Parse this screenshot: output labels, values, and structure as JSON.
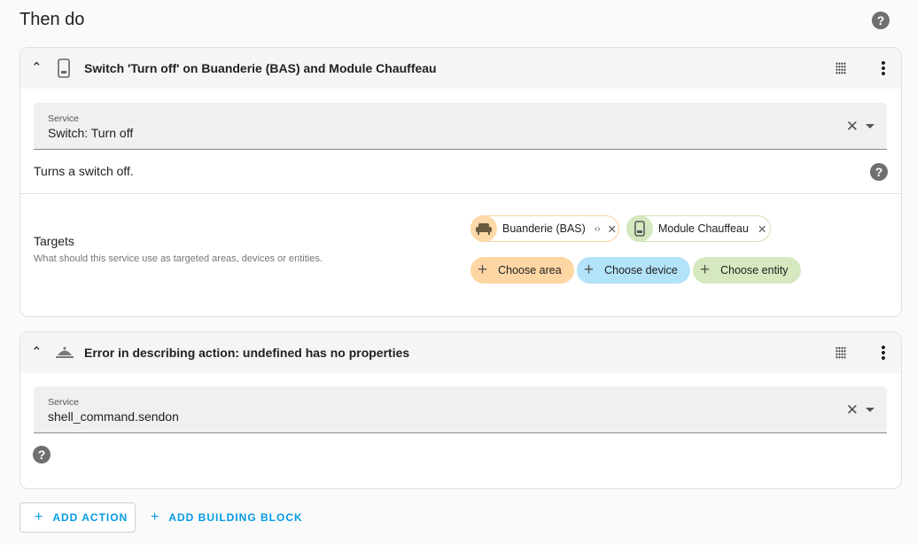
{
  "title": "Then do",
  "actions": [
    {
      "header": "Switch 'Turn off' on Buanderie (BAS) and Module Chauffeau",
      "service_label": "Service",
      "service_value": "Switch: Turn off",
      "description": "Turns a switch off.",
      "targets_title": "Targets",
      "targets_desc": "What should this service use as targeted areas, devices or entities.",
      "chips": [
        {
          "label": "Buanderie (BAS)",
          "color": "#fdd8a8"
        },
        {
          "label": "Module Chauffeau",
          "color": "#d4e8c0"
        }
      ],
      "add_buttons": [
        {
          "label": "Choose area",
          "color": "#fed6a4"
        },
        {
          "label": "Choose device",
          "color": "#b3e3f9"
        },
        {
          "label": "Choose entity",
          "color": "#d5e8bf"
        }
      ]
    },
    {
      "header": "Error in describing action: undefined has no properties",
      "service_label": "Service",
      "service_value": "shell_command.sendon"
    }
  ],
  "buttons": {
    "add_action": "ADD ACTION",
    "add_block": "ADD BUILDING BLOCK"
  },
  "help_glyph": "?"
}
